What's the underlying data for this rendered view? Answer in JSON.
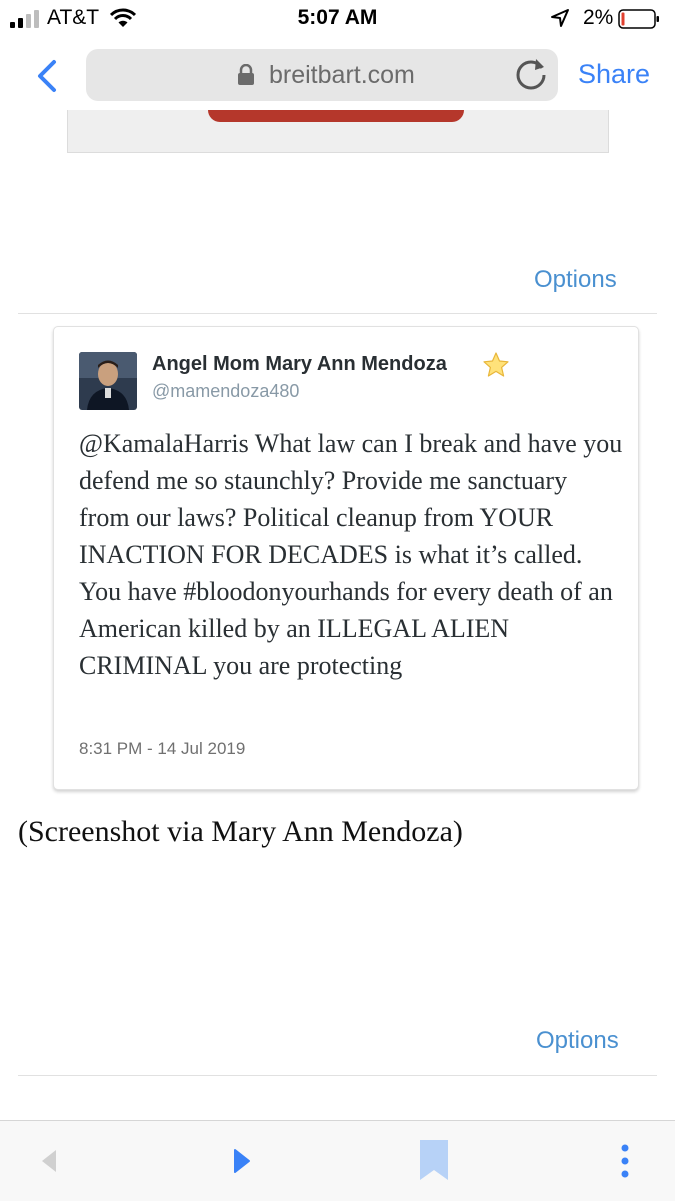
{
  "status_bar": {
    "carrier": "AT&T",
    "time": "5:07 AM",
    "battery_percent": "2%",
    "battery_level": 0.02,
    "icons": [
      "signal-icon",
      "wifi-icon",
      "location-arrow-icon",
      "battery-icon"
    ]
  },
  "browser": {
    "url": "breitbart.com",
    "share_label": "Share",
    "icons": [
      "back-chevron-icon",
      "lock-icon",
      "reload-icon"
    ]
  },
  "article": {
    "options_label_top": "Options",
    "options_label_bottom": "Options",
    "caption": "(Screenshot via Mary Ann Mendoza)"
  },
  "tweet": {
    "author_name": "Angel Mom Mary Ann Mendoza",
    "author_handle": "@mamendoza480",
    "text": "@KamalaHarris What law can I break and have you defend me so staunchly? Provide me sanctuary from our laws? Political cleanup from YOUR INACTION FOR DECADES is what it’s called. You have #bloodonyourhands for every death of an American killed by an ILLEGAL ALIEN CRIMINAL you are protecting",
    "timestamp": "8:31 PM - 14 Jul 2019"
  },
  "toolbar": {
    "icons": [
      "back-icon",
      "forward-icon",
      "bookmark-icon",
      "more-icon"
    ]
  },
  "colors": {
    "accent": "#3a82f7",
    "options_link": "#4a90d0",
    "battery_low": "#e0402f",
    "pill_red": "#b5372b"
  }
}
